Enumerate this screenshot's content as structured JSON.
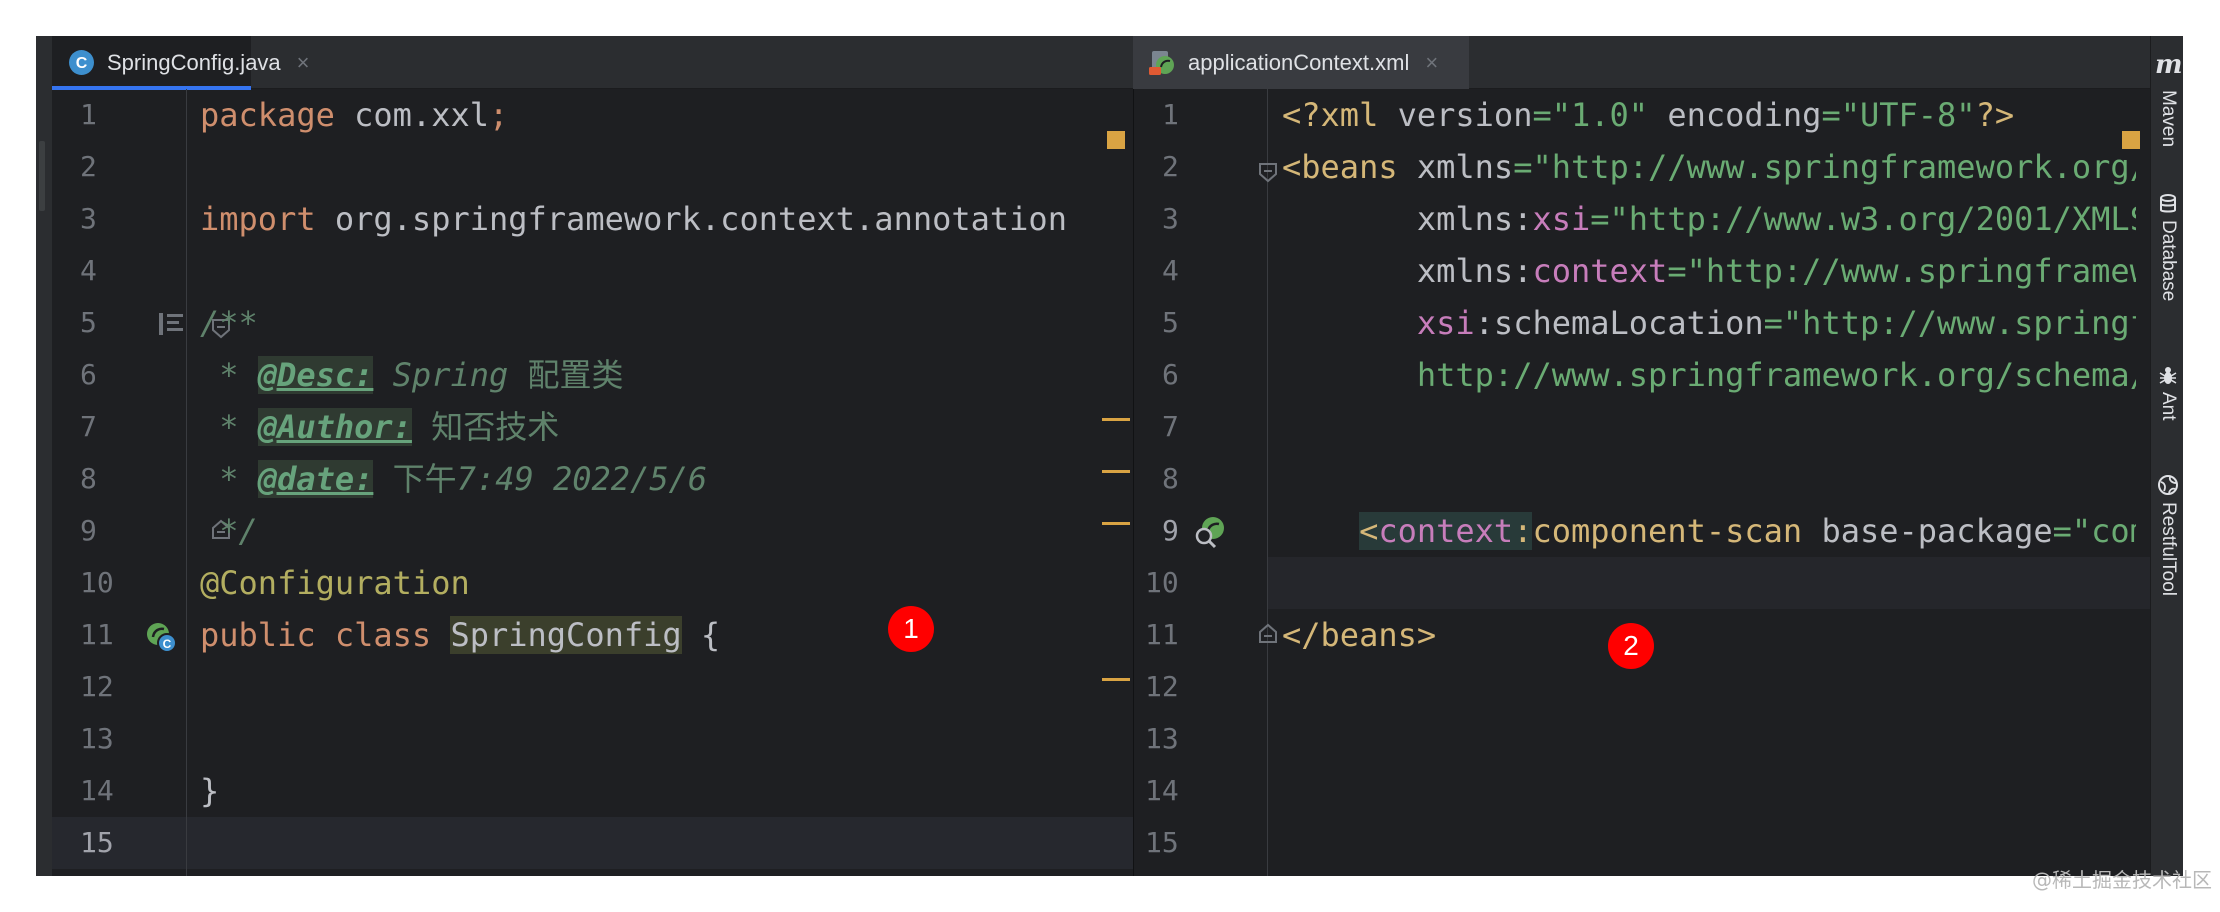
{
  "tabs": [
    {
      "label": "SpringConfig.java",
      "icon": "java-class-icon",
      "icon_letter": "C",
      "close": "×"
    },
    {
      "label": "applicationContext.xml",
      "icon": "spring-xml-icon",
      "close": "×"
    }
  ],
  "left_editor": {
    "line_numbers": [
      "1",
      "2",
      "3",
      "4",
      "5",
      "6",
      "7",
      "8",
      "9",
      "10",
      "11",
      "12",
      "13",
      "14",
      "15"
    ],
    "line1": {
      "kw": "package",
      "name": " com.xxl",
      "semi": ";"
    },
    "line3": {
      "kw": "import",
      "name": " org.springframework.context.annotation"
    },
    "line5": {
      "text": "/**"
    },
    "line6": {
      "star": " * ",
      "tag": "@Desc:",
      "text": " Spring ",
      "cjk": "配置类"
    },
    "line7": {
      "star": " * ",
      "tag": "@Author:",
      "text": " ",
      "cjk": "知否技术"
    },
    "line8": {
      "star": " * ",
      "tag": "@date:",
      "text": " ",
      "cjk": "下午",
      "text2": "7:49 2022/5/6"
    },
    "line9": {
      "text": " */"
    },
    "line10": {
      "text": "@Configuration"
    },
    "line11": {
      "kw1": "public",
      "kw2": "class",
      "name": "SpringConfig",
      "brace": " {"
    },
    "line14": {
      "text": "}"
    }
  },
  "right_editor": {
    "line_numbers": [
      "1",
      "2",
      "3",
      "4",
      "5",
      "6",
      "7",
      "8",
      "9",
      "10",
      "11",
      "12",
      "13",
      "14",
      "15"
    ],
    "line1": {
      "open": "<?xml ",
      "a1": "version",
      "eq": "=",
      "v1": "\"1.0\"",
      "a2": "encoding",
      "v2": "\"UTF-8\"",
      "close": "?>"
    },
    "line2": {
      "tag": "<beans ",
      "attr": "xmlns",
      "eq": "=",
      "val": "\"http://www.springframework.org/"
    },
    "line3": {
      "attr": "xmlns:",
      "ns": "xsi",
      "eq": "=",
      "val": "\"http://www.w3.org/2001/XMLS"
    },
    "line4": {
      "attr": "xmlns:",
      "ns": "context",
      "eq": "=",
      "val": "\"http://www.springframew"
    },
    "line5": {
      "ns": "xsi",
      "attr": ":schemaLocation",
      "eq": "=",
      "val": "\"http://www.springf"
    },
    "line6": {
      "val": "http://www.springframework.org/schema/"
    },
    "line9": {
      "lt": "<",
      "ns": "context",
      "colon": ":",
      "tag": "component-scan",
      "attr": " base-package",
      "eq": "=",
      "val": "\"com"
    },
    "line11": {
      "text": "</beans>"
    }
  },
  "badges": [
    "1",
    "2"
  ],
  "toolwindows": [
    "Maven",
    "Database",
    "Ant",
    "RestfulTool"
  ],
  "toolwindow_logo": "m",
  "watermark": "@稀土掘金技术社区",
  "colors": {
    "background": "#1e1f22",
    "keyword": "#cf8e6d",
    "string": "#6aab73",
    "xml_tag": "#d5b778",
    "xml_namespace": "#c77dbb",
    "doc_comment": "#5f826b",
    "annotation": "#b3ae60",
    "active_tab_underline": "#3574f0",
    "badge": "#ff0000",
    "warning": "#d9a343"
  }
}
